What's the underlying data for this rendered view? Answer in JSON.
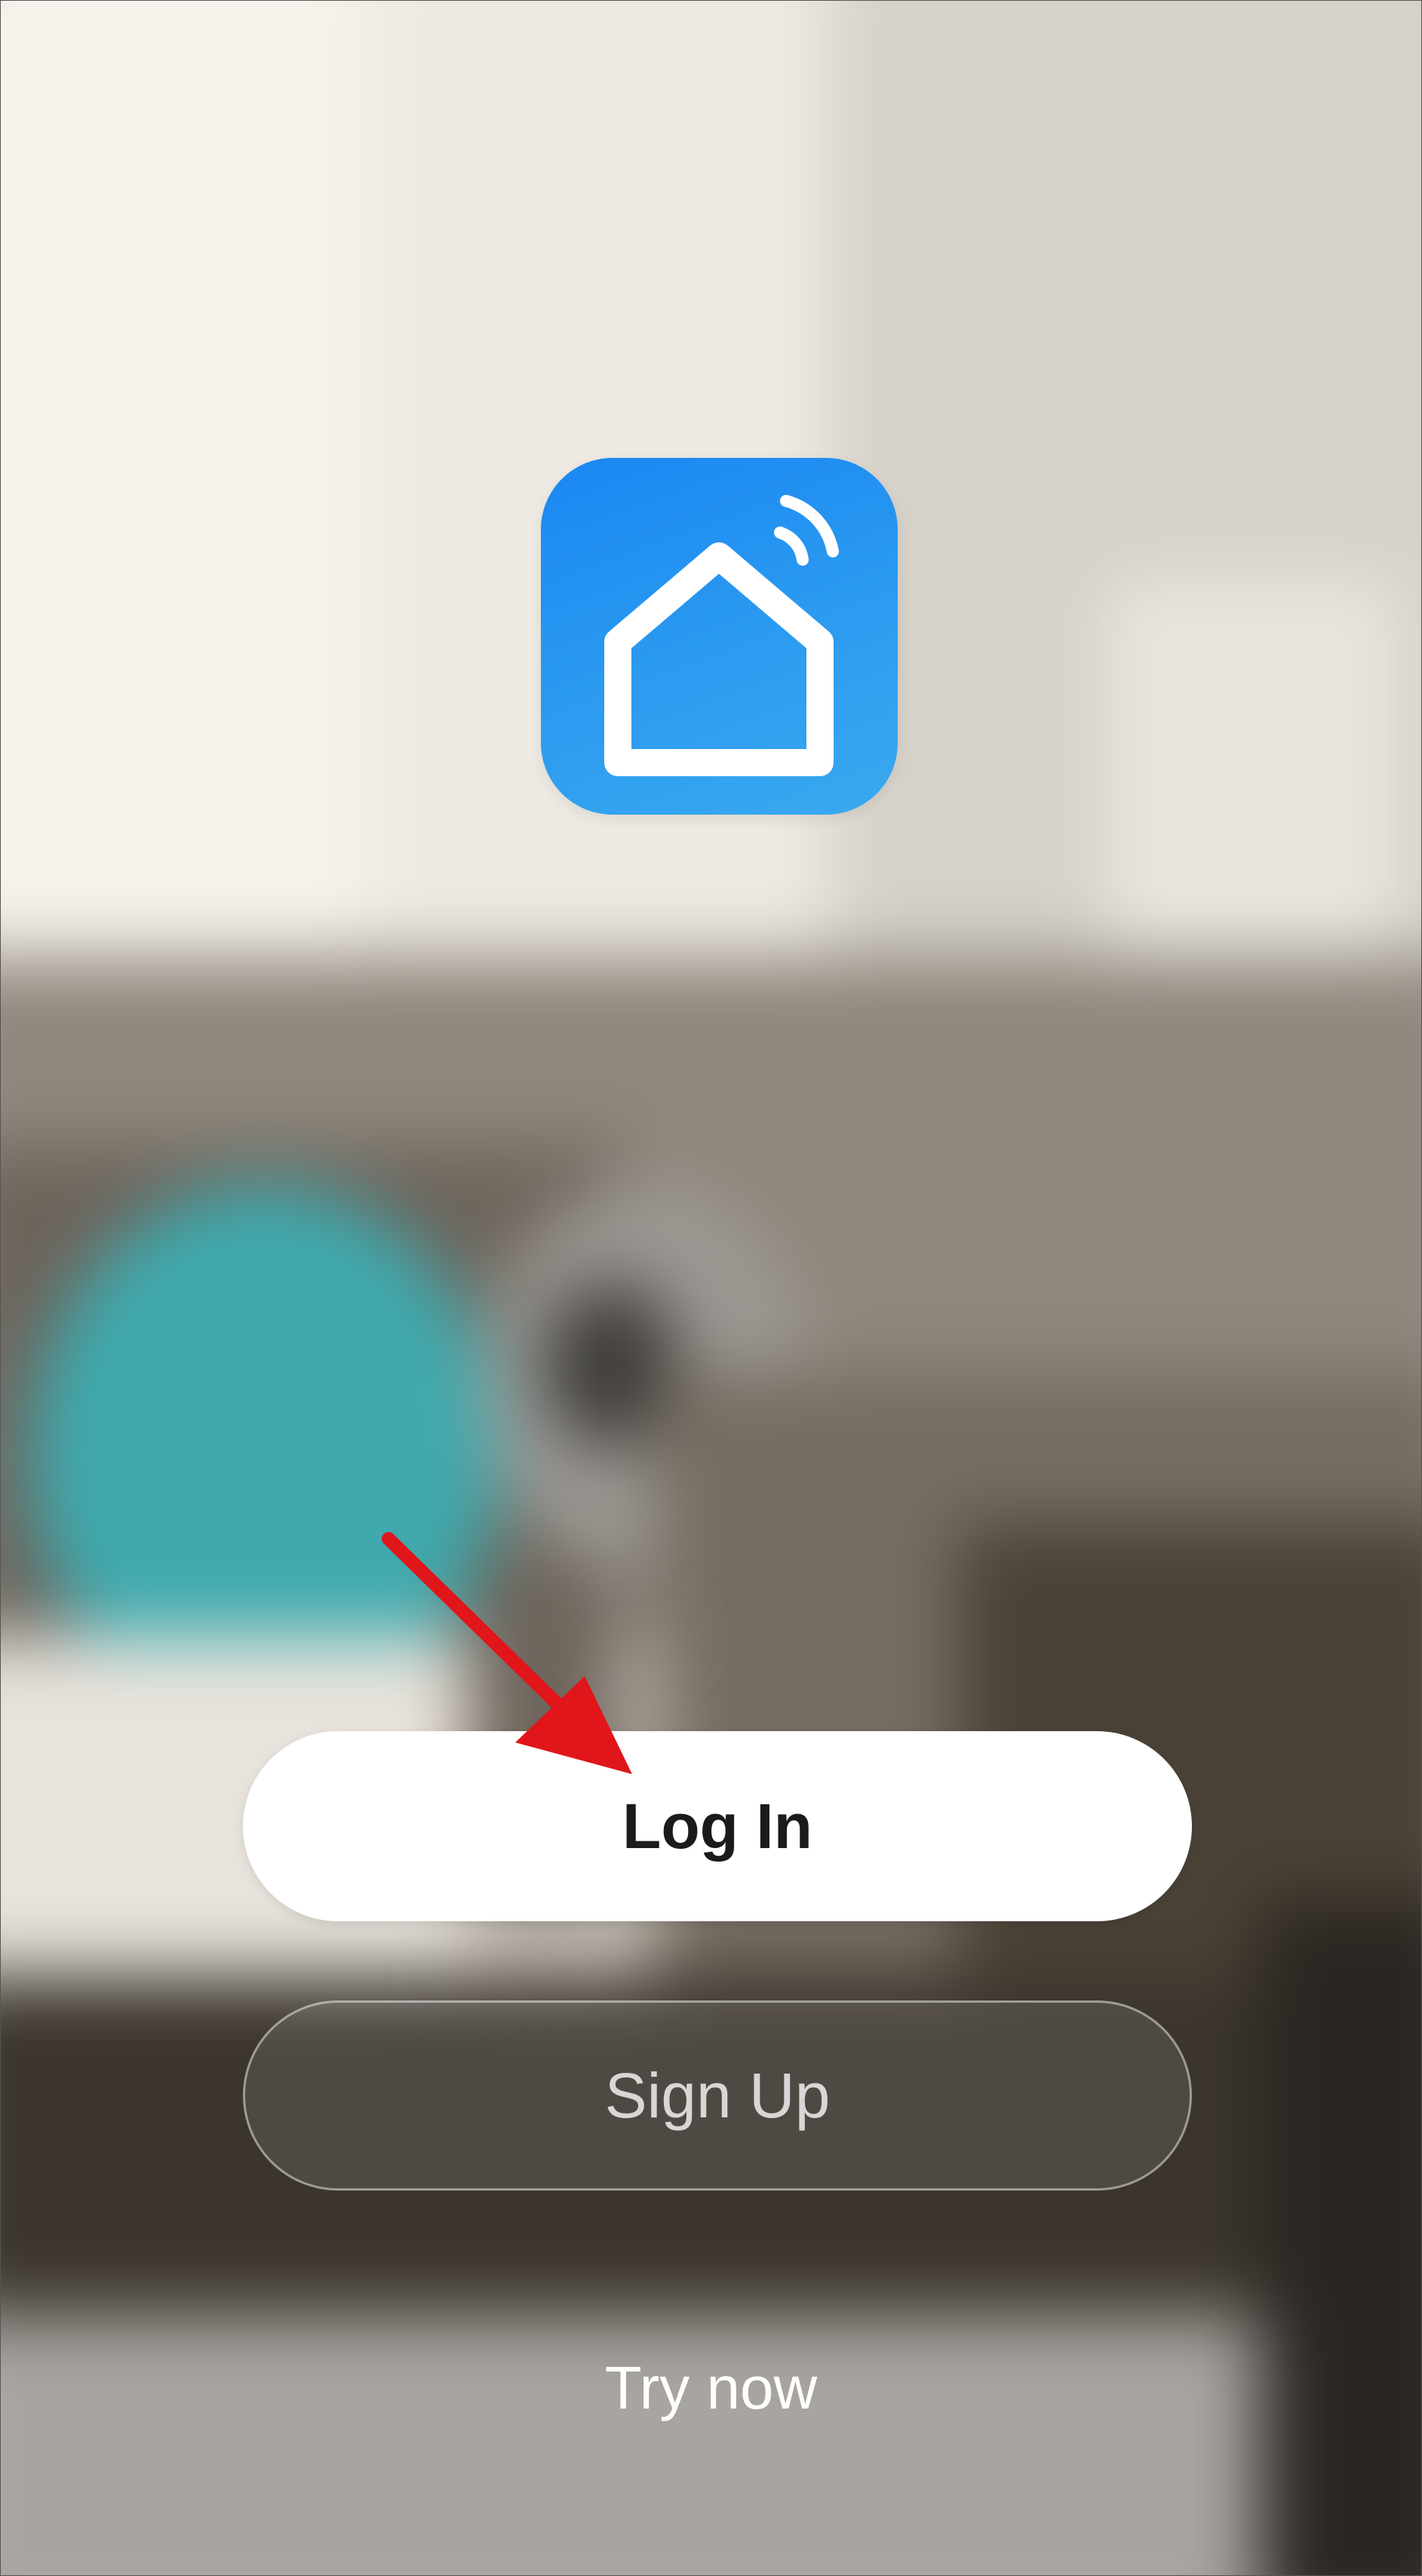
{
  "app": {
    "logo_icon": "smart-home-wifi-icon",
    "logo_color": "#2196F3"
  },
  "auth": {
    "login_label": "Log In",
    "signup_label": "Sign Up",
    "try_now_label": "Try now"
  },
  "annotation": {
    "arrow_color": "#e0161b"
  }
}
